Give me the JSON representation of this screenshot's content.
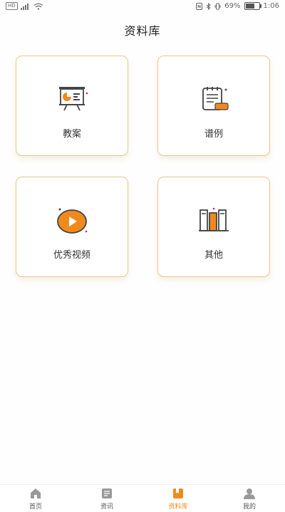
{
  "status": {
    "hd": "HD",
    "battery_text": "69%",
    "battery_level": 0.69,
    "time": "1:06"
  },
  "page": {
    "title": "资料库"
  },
  "cards": [
    {
      "label": "教案",
      "icon": "presentation-board-icon"
    },
    {
      "label": "谱例",
      "icon": "notepad-icon"
    },
    {
      "label": "优秀视频",
      "icon": "video-play-icon"
    },
    {
      "label": "其他",
      "icon": "books-icon"
    }
  ],
  "tabs": [
    {
      "label": "首页",
      "icon": "home-icon",
      "active": false
    },
    {
      "label": "资讯",
      "icon": "news-icon",
      "active": false
    },
    {
      "label": "资料库",
      "icon": "library-icon",
      "active": true
    },
    {
      "label": "我的",
      "icon": "user-icon",
      "active": false
    }
  ],
  "colors": {
    "accent": "#f08a1c",
    "card_border": "#e6c98b"
  }
}
